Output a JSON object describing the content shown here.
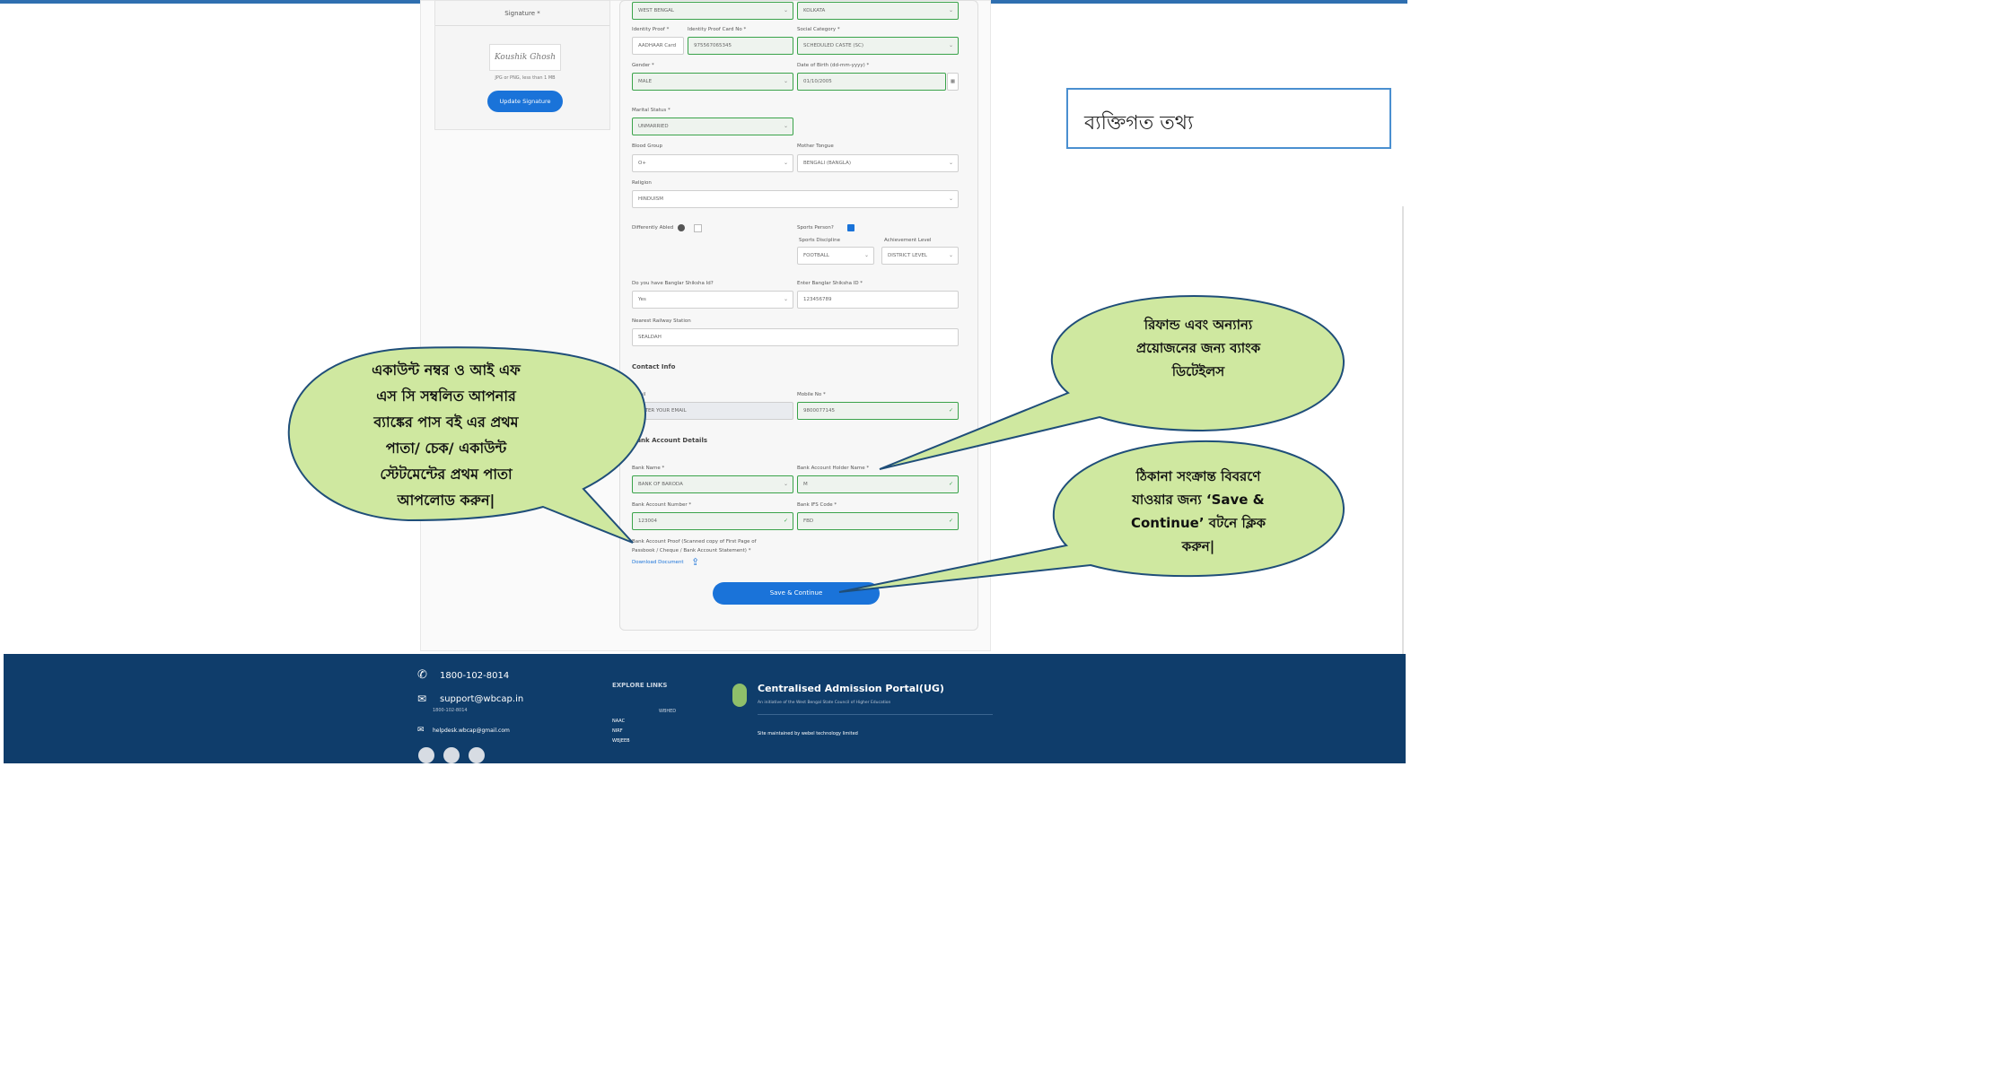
{
  "signature_panel": {
    "title": "Signature *",
    "signature_text": "Koushik Ghosh",
    "note": "JPG or PNG, less than 1 MB",
    "update_button": "Update Signature"
  },
  "form": {
    "rows": [
      {
        "label": "",
        "value": "WEST BENGAL",
        "label2": "",
        "value2": "KOLKATA"
      },
      {
        "label": "Identity Proof *",
        "value": "AADHAAR Card",
        "label_b": "Identity Proof Card No *",
        "value_b": "975567065345",
        "label2": "Social Category *",
        "value2": "SCHEDULED CASTE (SC)"
      },
      {
        "label": "Gender *",
        "value": "MALE",
        "label2": "Date of Birth (dd-mm-yyyy) *",
        "value2": "01/10/2005"
      },
      {
        "label": "Marital Status *",
        "value": "UNMARRIED"
      },
      {
        "label": "Blood Group",
        "value": "O+",
        "label2": "Mother Tongue",
        "value2": "BENGALI (BANGLA)"
      },
      {
        "label": "Religion",
        "value": "HINDUISM"
      }
    ],
    "differently_abled": "Differently Abled",
    "sports_person": "Sports Person?",
    "sports_discipline_label": "Sports Discipline",
    "sports_discipline": "FOOTBALL",
    "achievement_label": "Achievement Level",
    "achievement": "DISTRICT LEVEL",
    "bangla_shiksha_label": "Do you have Banglar Shiksha Id?",
    "bangla_shiksha_value": "Yes",
    "bangla_id_label": "Enter Banglar Shiksha ID *",
    "bangla_id_value": "123456789",
    "railway_label": "Nearest Railway Station",
    "railway_value": "SEALDAH",
    "contact_title": "Contact Info",
    "email_label": "Email",
    "email_value": "ENTER YOUR EMAIL",
    "mobile_label": "Mobile No *",
    "mobile_value": "9800077145",
    "bank_title": "Bank Account Details",
    "bank_name_label": "Bank Name *",
    "bank_name_value": "BANK OF BARODA",
    "holder_label": "Bank Account Holder Name *",
    "holder_value": "M",
    "acc_no_label": "Bank Account Number *",
    "acc_no_value": "123004",
    "ifsc_label": "Bank IFS Code *",
    "ifsc_value": "FBD",
    "proof_label_1": "Bank Account Proof (Scanned copy of First Page of",
    "proof_label_2": "Passbook / Cheque / Bank Account Statement) *",
    "download_label": "Download Document",
    "save_button": "Save & Continue"
  },
  "annotations": {
    "personal_info": "ব্যক্তিগত তথ্য",
    "bubble_left": [
      "একাউন্ট নম্বর ও আই এফ",
      "এস সি সম্বলিত আপনার",
      "ব্যাঙ্কের পাস বই এর প্রথম",
      "পাতা/ চেক/ একাউন্ট",
      "স্টেটমেন্টের প্রথম পাতা",
      "আপলোড করুন|"
    ],
    "bubble_right_top": [
      "রিফান্ড এবং অন্যান্য",
      "প্রয়োজনের জন্য ব্যাংক",
      "ডিটেইলস"
    ],
    "bubble_right_bottom": [
      "ঠিকানা সংক্রান্ত বিবরণে",
      "যাওয়ার জন্য  ‘Save &",
      "Continue’ বটনে ক্লিক",
      "করুন|"
    ]
  },
  "footer": {
    "phone": "1800-102-8014",
    "email": "support@wbcap.in",
    "phone_small": "1800-102-8014",
    "email_small": "helpdesk.wbcap@gmail.com",
    "explore_title": "EXPLORE LINKS",
    "links": [
      "NAAC",
      "NIRF",
      "WBJEEB"
    ],
    "links_right": "WBHED",
    "portal_title": "Centralised Admission Portal(UG)",
    "portal_sub": "An initiative of the West Bengal State Council of Higher Education",
    "maintained": "Site maintained by webel technology limited"
  },
  "colors": {
    "accent": "#1a73d9",
    "bubble_fill": "#cfe8a0",
    "bubble_stroke": "#1f4e79",
    "footer_bg": "#0f3d6b",
    "success": "#3aa34a"
  }
}
